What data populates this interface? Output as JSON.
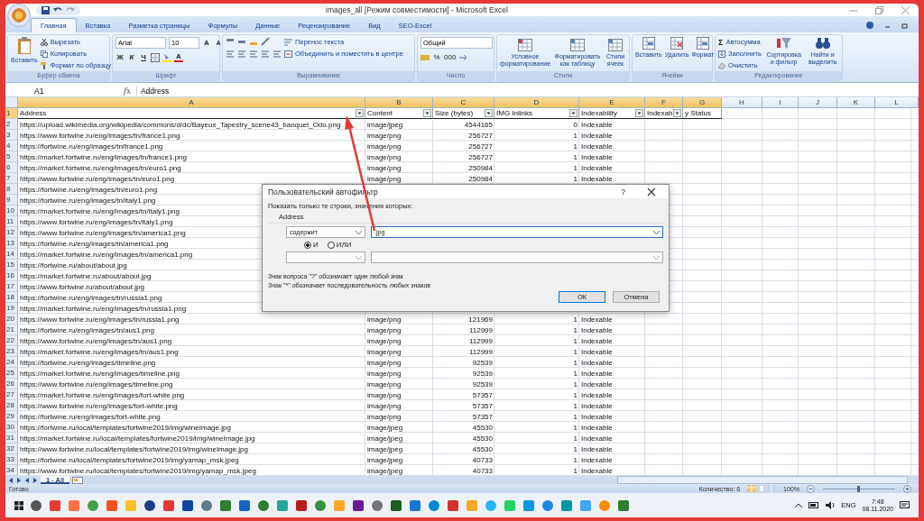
{
  "window": {
    "title": "images_all  [Режим совместимости] - Microsoft Excel"
  },
  "ribbon_tabs": [
    {
      "label": "Главная",
      "selected": true
    },
    {
      "label": "Вставка",
      "selected": false
    },
    {
      "label": "Разметка страницы",
      "selected": false
    },
    {
      "label": "Формулы",
      "selected": false
    },
    {
      "label": "Данные",
      "selected": false
    },
    {
      "label": "Рецензирование",
      "selected": false
    },
    {
      "label": "Вид",
      "selected": false
    },
    {
      "label": "SEO-Excel",
      "selected": false
    }
  ],
  "ribbon": {
    "clipboard": {
      "paste": "Вставить",
      "cut": "Вырезать",
      "copy": "Копировать",
      "format_painter": "Формат по образцу",
      "label": "Буфер обмена"
    },
    "font": {
      "name": "Arial",
      "size": "10",
      "bold": "Ж",
      "italic": "К",
      "underline": "Ч",
      "grow": "A",
      "shrink": "A",
      "font_color": "A",
      "label": "Шрифт"
    },
    "alignment": {
      "wrap_text": "Перенос текста",
      "merge": "Объединить и поместить в центре",
      "label": "Выравнивание"
    },
    "number": {
      "format": "Общий",
      "percent": "%",
      "thousands": "000",
      "label": "Число"
    },
    "styles": {
      "items": [
        "Условное форматирование",
        "Форматировать как таблицу",
        "Стили ячеек"
      ],
      "label": "Стили"
    },
    "cells": {
      "items": [
        "Вставить",
        "Удалить",
        "Формат"
      ],
      "label": "Ячейки"
    },
    "editing": {
      "autosum_symbol": "Σ",
      "autosum": "Автосумма",
      "fill": "Заполнить",
      "clear": "Очистить",
      "sort_filter": "Сортировка и фильтр",
      "find_select": "Найти и выделить",
      "label": "Редактирование"
    }
  },
  "formula_bar": {
    "name_box": "A1",
    "fx": "fx",
    "value": "Address"
  },
  "sheet": {
    "columns": [
      {
        "letter": "A",
        "selected": true
      },
      {
        "letter": "B",
        "selected": true
      },
      {
        "letter": "C",
        "selected": true
      },
      {
        "letter": "D",
        "selected": true
      },
      {
        "letter": "E",
        "selected": true
      },
      {
        "letter": "F",
        "selected": true
      },
      {
        "letter": "G",
        "selected": true
      },
      {
        "letter": "H",
        "selected": false
      },
      {
        "letter": "I",
        "selected": false
      },
      {
        "letter": "J",
        "selected": false
      },
      {
        "letter": "K",
        "selected": false
      },
      {
        "letter": "L",
        "selected": false
      }
    ],
    "header_row": {
      "n": "1",
      "selected": true,
      "cells": [
        {
          "text": "Address",
          "filter": true
        },
        {
          "text": "Content",
          "filter": true
        },
        {
          "text": "Size (bytes)",
          "filter": true
        },
        {
          "text": "IMG Inlinks",
          "filter": true
        },
        {
          "text": "Indexability",
          "filter": true
        },
        {
          "text": "Indexab",
          "filter": true
        },
        {
          "text": "y Status",
          "filter": false
        }
      ]
    },
    "rows": [
      {
        "n": "2",
        "address": "https://upload.wikimedia.org/wikipedia/commons/d/dc/Bayeux_Tapestry_scene43_banquet_Odo.png",
        "content": "image/jpeg",
        "size": "4544165",
        "inlinks": "0",
        "indexability": "Indexable"
      },
      {
        "n": "3",
        "address": "https://www.fortwine.ru/eng/images/tn/france1.png",
        "content": "image/png",
        "size": "256727",
        "inlinks": "1",
        "indexability": "Indexable"
      },
      {
        "n": "4",
        "address": "https://fortwine.ru/eng/images/tn/france1.png",
        "content": "image/png",
        "size": "256727",
        "inlinks": "1",
        "indexability": "Indexable"
      },
      {
        "n": "5",
        "address": "https://market.fortwine.ru/eng/images/tn/france1.png",
        "content": "image/png",
        "size": "256727",
        "inlinks": "1",
        "indexability": "Indexable"
      },
      {
        "n": "6",
        "address": "https://market.fortwine.ru/eng/images/tn/euro1.png",
        "content": "image/png",
        "size": "250984",
        "inlinks": "1",
        "indexability": "Indexable"
      },
      {
        "n": "7",
        "address": "https://www.fortwine.ru/eng/images/tn/euro1.png",
        "content": "image/png",
        "size": "250984",
        "inlinks": "1",
        "indexability": "Indexable"
      },
      {
        "n": "8",
        "address": "https://fortwine.ru/eng/images/tn/euro1.png"
      },
      {
        "n": "9",
        "address": "https://fortwine.ru/eng/images/tn/italy1.png"
      },
      {
        "n": "10",
        "address": "https://market.fortwine.ru/eng/images/tn/italy1.png"
      },
      {
        "n": "11",
        "address": "https://www.fortwine.ru/eng/images/tn/italy1.png"
      },
      {
        "n": "12",
        "address": "https://www.fortwine.ru/eng/images/tn/america1.png"
      },
      {
        "n": "13",
        "address": "https://fortwine.ru/eng/images/tn/america1.png"
      },
      {
        "n": "14",
        "address": "https://market.fortwine.ru/eng/images/tn/america1.png"
      },
      {
        "n": "15",
        "address": "https://fortwine.ru/about/about.jpg"
      },
      {
        "n": "16",
        "address": "https://market.fortwine.ru/about/about.jpg"
      },
      {
        "n": "17",
        "address": "https://www.fortwine.ru/about/about.jpg"
      },
      {
        "n": "18",
        "address": "https://fortwine.ru/eng/images/tn/russia1.png"
      },
      {
        "n": "19",
        "address": "https://market.fortwine.ru/eng/images/tn/russia1.png"
      },
      {
        "n": "20",
        "address": "https://www.fortwine.ru/eng/images/tn/russia1.png",
        "content": "image/png",
        "size": "121969",
        "inlinks": "1",
        "indexability": "Indexable"
      },
      {
        "n": "21",
        "address": "https://fortwine.ru/eng/images/tn/aus1.png",
        "content": "image/png",
        "size": "112999",
        "inlinks": "1",
        "indexability": "Indexable"
      },
      {
        "n": "22",
        "address": "https://www.fortwine.ru/eng/images/tn/aus1.png",
        "content": "image/png",
        "size": "112999",
        "inlinks": "1",
        "indexability": "Indexable"
      },
      {
        "n": "23",
        "address": "https://market.fortwine.ru/eng/images/tn/aus1.png",
        "content": "image/png",
        "size": "112999",
        "inlinks": "1",
        "indexability": "Indexable"
      },
      {
        "n": "24",
        "address": "https://fortwine.ru/eng/images/timeline.png",
        "content": "image/png",
        "size": "92539",
        "inlinks": "1",
        "indexability": "Indexable"
      },
      {
        "n": "25",
        "address": "https://market.fortwine.ru/eng/images/timeline.png",
        "content": "image/png",
        "size": "92539",
        "inlinks": "1",
        "indexability": "Indexable"
      },
      {
        "n": "26",
        "address": "https://www.fortwine.ru/eng/images/timeline.png",
        "content": "image/png",
        "size": "92539",
        "inlinks": "1",
        "indexability": "Indexable"
      },
      {
        "n": "27",
        "address": "https://market.fortwine.ru/eng/images/fort-white.png",
        "content": "image/png",
        "size": "57357",
        "inlinks": "1",
        "indexability": "Indexable"
      },
      {
        "n": "28",
        "address": "https://www.fortwine.ru/eng/images/fort-white.png",
        "content": "image/png",
        "size": "57357",
        "inlinks": "1",
        "indexability": "Indexable"
      },
      {
        "n": "29",
        "address": "https://fortwine.ru/eng/images/fort-white.png",
        "content": "image/png",
        "size": "57357",
        "inlinks": "1",
        "indexability": "Indexable"
      },
      {
        "n": "30",
        "address": "https://fortwine.ru/local/templates/fortwine2019/img/wineImage.jpg",
        "content": "image/jpeg",
        "size": "45530",
        "inlinks": "1",
        "indexability": "Indexable"
      },
      {
        "n": "31",
        "address": "https://market.fortwine.ru/local/templates/fortwine2019/img/wineImage.jpg",
        "content": "image/jpeg",
        "size": "45530",
        "inlinks": "1",
        "indexability": "Indexable"
      },
      {
        "n": "32",
        "address": "https://www.fortwine.ru/local/templates/fortwine2019/img/wineImage.jpg",
        "content": "image/jpeg",
        "size": "45530",
        "inlinks": "1",
        "indexability": "Indexable"
      },
      {
        "n": "33",
        "address": "https://fortwine.ru/local/templates/fortwine2019/img/yamap_msk.jpeg",
        "content": "image/jpeg",
        "size": "40733",
        "inlinks": "1",
        "indexability": "Indexable"
      },
      {
        "n": "34",
        "address": "https://www.fortwine.ru/local/templates/fortwine2019/img/yamap_msk.jpeg",
        "content": "image/jpeg",
        "size": "40733",
        "inlinks": "1",
        "indexability": "Indexable"
      }
    ]
  },
  "sheet_tabs": [
    {
      "label": "1 - All",
      "selected": true
    }
  ],
  "status_bar": {
    "ready": "Готово",
    "count": "Количество: 6",
    "zoom": "100%",
    "zoom_slider": {
      "level": 0.5
    }
  },
  "dialog": {
    "title": "Пользовательский автофильтр",
    "help": "?",
    "prompt": "Показать только те строки, значения которых:",
    "field": "Address",
    "operator": "содержит",
    "value": ".jpg",
    "logic": [
      {
        "label": "И",
        "selected": true
      },
      {
        "label": "ИЛИ",
        "selected": false
      }
    ],
    "hints": [
      "Знак вопроса \"?\" обозначает один любой знак",
      "Знак \"*\" обозначает последовательность любых знаков"
    ],
    "ok": "ОК",
    "cancel": "Отмена"
  },
  "taskbar": {
    "language": "ENG",
    "time": "7:48",
    "date": "08.11.2020"
  }
}
